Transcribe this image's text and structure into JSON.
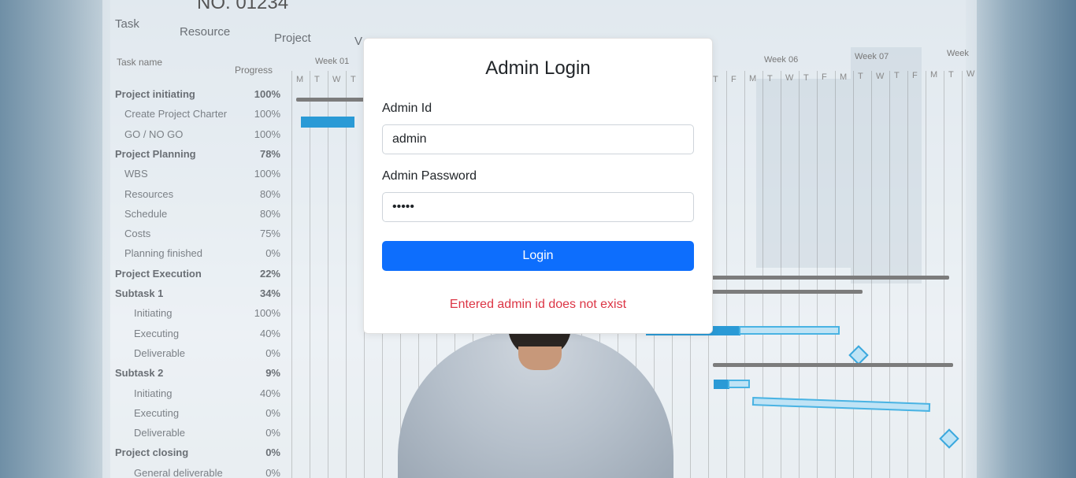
{
  "background": {
    "tabs": [
      "Task",
      "Resource",
      "Project",
      "V"
    ],
    "title_fragment": "NO. 01234",
    "columns": {
      "task_name": "Task name",
      "progress": "Progress"
    },
    "weeks": [
      "Week 01",
      "Week 06",
      "Week 07",
      "Week"
    ],
    "days_left": [
      "M",
      "T",
      "W",
      "T"
    ],
    "days_right": [
      "T",
      "F",
      "M",
      "T",
      "W",
      "T",
      "F",
      "M",
      "T",
      "W",
      "T",
      "F",
      "M",
      "T",
      "W"
    ],
    "tasks": [
      {
        "name": "Project initiating",
        "progress": "100%",
        "bold": true
      },
      {
        "name": "Create Project Charter",
        "progress": "100%",
        "bold": false
      },
      {
        "name": "GO / NO GO",
        "progress": "100%",
        "bold": false
      },
      {
        "name": "Project Planning",
        "progress": "78%",
        "bold": true
      },
      {
        "name": "WBS",
        "progress": "100%",
        "bold": false
      },
      {
        "name": "Resources",
        "progress": "80%",
        "bold": false
      },
      {
        "name": "Schedule",
        "progress": "80%",
        "bold": false
      },
      {
        "name": "Costs",
        "progress": "75%",
        "bold": false
      },
      {
        "name": "Planning finished",
        "progress": "0%",
        "bold": false
      },
      {
        "name": "Project Execution",
        "progress": "22%",
        "bold": true
      },
      {
        "name": "Subtask 1",
        "progress": "34%",
        "bold": true
      },
      {
        "name": "Initiating",
        "progress": "100%",
        "bold": false
      },
      {
        "name": "Executing",
        "progress": "40%",
        "bold": false
      },
      {
        "name": "Deliverable",
        "progress": "0%",
        "bold": false
      },
      {
        "name": "Subtask 2",
        "progress": "9%",
        "bold": true
      },
      {
        "name": "Initiating",
        "progress": "40%",
        "bold": false
      },
      {
        "name": "Executing",
        "progress": "0%",
        "bold": false
      },
      {
        "name": "Deliverable",
        "progress": "0%",
        "bold": false
      },
      {
        "name": "Project closing",
        "progress": "0%",
        "bold": true
      },
      {
        "name": "General deliverable",
        "progress": "0%",
        "bold": false
      }
    ]
  },
  "login": {
    "title": "Admin Login",
    "id_label": "Admin Id",
    "id_value": "admin",
    "password_label": "Admin Password",
    "password_value": "admin",
    "button_label": "Login",
    "error": "Entered admin id does not exist"
  },
  "colors": {
    "primary": "#0d6efd",
    "error": "#dc3545",
    "gantt_blue": "#2a9ad6"
  }
}
